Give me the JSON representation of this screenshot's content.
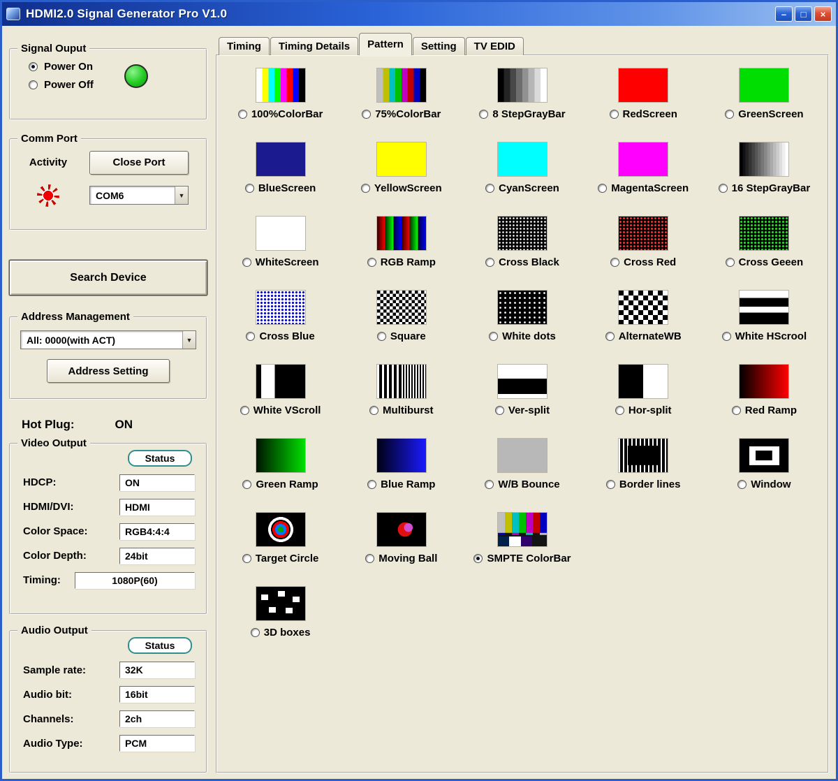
{
  "window": {
    "title": "HDMI2.0 Signal Generator Pro V1.0",
    "controls": {
      "minimize": "–",
      "maximize": "□",
      "close": "×"
    }
  },
  "colors": {
    "titlebar_blue": "#2a63d8",
    "power_led_green": "#22cc22",
    "activity_led_red": "#dd0000",
    "panel_beige": "#ECE9D8"
  },
  "left": {
    "signal_output": {
      "title": "Signal Ouput",
      "power_on": "Power On",
      "power_off": "Power Off"
    },
    "comm_port": {
      "title": "Comm Port",
      "activity": "Activity",
      "close_port": "Close Port",
      "com": "COM6",
      "dropdown_arrow": "▼"
    },
    "search_device": "Search Device",
    "address_management": {
      "title": "Address Management",
      "value": "All: 0000(with ACT)",
      "dropdown_arrow": "▼",
      "address_setting": "Address Setting"
    },
    "hot_plug": {
      "label": "Hot Plug:",
      "value": "ON"
    },
    "video_output": {
      "title": "Video Output",
      "status": "Status",
      "fields": [
        {
          "label": "HDCP:",
          "value": "ON"
        },
        {
          "label": "HDMI/DVI:",
          "value": "HDMI"
        },
        {
          "label": "Color Space:",
          "value": "RGB4:4:4"
        },
        {
          "label": "Color Depth:",
          "value": "24bit"
        },
        {
          "label": "Timing:",
          "value": "1080P(60)"
        }
      ]
    },
    "audio_output": {
      "title": "Audio Output",
      "status": "Status",
      "fields": [
        {
          "label": "Sample rate:",
          "value": "32K"
        },
        {
          "label": "Audio bit:",
          "value": "16bit"
        },
        {
          "label": "Channels:",
          "value": "2ch"
        },
        {
          "label": "Audio Type:",
          "value": "PCM"
        }
      ]
    }
  },
  "tabs": [
    {
      "label": "Timing",
      "active": false
    },
    {
      "label": "Timing Details",
      "active": false
    },
    {
      "label": "Pattern",
      "active": true
    },
    {
      "label": "Setting",
      "active": false
    },
    {
      "label": "TV EDID",
      "active": false
    }
  ],
  "patterns": [
    {
      "label": "100%ColorBar",
      "key": "colorbar100",
      "selected": false
    },
    {
      "label": "75%ColorBar",
      "key": "colorbar75",
      "selected": false
    },
    {
      "label": "8 StepGrayBar",
      "key": "gray8",
      "selected": false
    },
    {
      "label": "RedScreen",
      "key": "red",
      "selected": false
    },
    {
      "label": "GreenScreen",
      "key": "green",
      "selected": false
    },
    {
      "label": "BlueScreen",
      "key": "blue",
      "selected": false
    },
    {
      "label": "YellowScreen",
      "key": "yellow",
      "selected": false
    },
    {
      "label": "CyanScreen",
      "key": "cyan",
      "selected": false
    },
    {
      "label": "MagentaScreen",
      "key": "magenta",
      "selected": false
    },
    {
      "label": "16 StepGrayBar",
      "key": "gray16",
      "selected": false
    },
    {
      "label": "WhiteScreen",
      "key": "white",
      "selected": false
    },
    {
      "label": "RGB Ramp",
      "key": "rgbramp",
      "selected": false
    },
    {
      "label": "Cross Black",
      "key": "crossblack",
      "selected": false
    },
    {
      "label": "Cross Red",
      "key": "crossred",
      "selected": false
    },
    {
      "label": "Cross Geeen",
      "key": "crossgreen",
      "selected": false
    },
    {
      "label": "Cross Blue",
      "key": "crossblue",
      "selected": false
    },
    {
      "label": "Square",
      "key": "square",
      "selected": false
    },
    {
      "label": "White dots",
      "key": "whitedots",
      "selected": false
    },
    {
      "label": "AlternateWB",
      "key": "alternatewb",
      "selected": false
    },
    {
      "label": "White HScrool",
      "key": "whitehscroll",
      "selected": false
    },
    {
      "label": "White VScroll",
      "key": "whitevscroll",
      "selected": false
    },
    {
      "label": "Multiburst",
      "key": "multiburst",
      "selected": false
    },
    {
      "label": "Ver-split",
      "key": "versplit",
      "selected": false
    },
    {
      "label": "Hor-split",
      "key": "horsplit",
      "selected": false
    },
    {
      "label": "Red Ramp",
      "key": "redramp",
      "selected": false
    },
    {
      "label": "Green Ramp",
      "key": "greenramp",
      "selected": false
    },
    {
      "label": "Blue Ramp",
      "key": "blueramp",
      "selected": false
    },
    {
      "label": "W/B Bounce",
      "key": "wbbounce",
      "selected": false
    },
    {
      "label": "Border lines",
      "key": "borderlines",
      "selected": false
    },
    {
      "label": "Window",
      "key": "window",
      "selected": false
    },
    {
      "label": "Target Circle",
      "key": "targetcircle",
      "selected": false
    },
    {
      "label": "Moving Ball",
      "key": "movingball",
      "selected": false
    },
    {
      "label": "SMPTE ColorBar",
      "key": "smpte",
      "selected": true
    },
    {
      "label": "3D boxes",
      "key": "boxes3d",
      "selected": false,
      "newrow": true
    }
  ]
}
